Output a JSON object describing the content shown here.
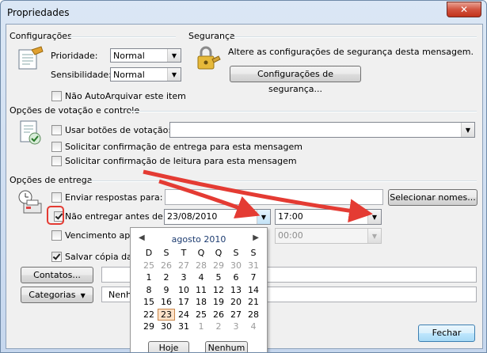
{
  "window": {
    "title": "Propriedades",
    "close_label": "✕"
  },
  "settings": {
    "section_label": "Configurações",
    "priority_label": "Prioridade:",
    "priority_value": "Normal",
    "sensitivity_label": "Sensibilidade:",
    "sensitivity_value": "Normal",
    "no_autoarchive_label": "Não AutoArquivar este item",
    "no_autoarchive_checked": false
  },
  "security": {
    "section_label": "Segurança",
    "description": "Altere as configurações de segurança desta mensagem.",
    "button_label": "Configurações de segurança..."
  },
  "voting": {
    "section_label": "Opções de votação e controle",
    "use_voting_label": "Usar botões de votação:",
    "use_voting_checked": false,
    "voting_value": "",
    "delivery_receipt_label": "Solicitar confirmação de entrega para esta mensagem",
    "delivery_receipt_checked": false,
    "read_receipt_label": "Solicitar confirmação de leitura para esta mensagem",
    "read_receipt_checked": false
  },
  "delivery": {
    "section_label": "Opções de entrega",
    "send_replies_label": "Enviar respostas para:",
    "send_replies_checked": false,
    "send_replies_value": "",
    "select_names_label": "Selecionar nomes...",
    "do_not_deliver_label": "Não entregar antes de:",
    "do_not_deliver_checked": true,
    "do_not_deliver_date": "23/08/2010",
    "do_not_deliver_time": "17:00",
    "expires_label": "Vencimento após:",
    "expires_checked": false,
    "expires_time": "00:00",
    "save_copy_label": "Salvar cópia da m",
    "save_copy_checked": true
  },
  "bottom": {
    "contacts_label": "Contatos...",
    "contacts_value": "",
    "categories_label": "Categorias",
    "categories_value": "Nenh",
    "close_button_label": "Fechar"
  },
  "calendar": {
    "month_label": "agosto 2010",
    "prev_icon": "◀",
    "next_icon": "▶",
    "weekday_headers": [
      "D",
      "S",
      "T",
      "Q",
      "Q",
      "S",
      "S"
    ],
    "weeks": [
      [
        "25",
        "26",
        "27",
        "28",
        "29",
        "30",
        "31"
      ],
      [
        "1",
        "2",
        "3",
        "4",
        "5",
        "6",
        "7"
      ],
      [
        "8",
        "9",
        "10",
        "11",
        "12",
        "13",
        "14"
      ],
      [
        "15",
        "16",
        "17",
        "18",
        "19",
        "20",
        "21"
      ],
      [
        "22",
        "23",
        "24",
        "25",
        "26",
        "27",
        "28"
      ],
      [
        "29",
        "30",
        "31",
        "1",
        "2",
        "3",
        "4"
      ]
    ],
    "selected_day": "23",
    "today_button": "Hoje",
    "none_button": "Nenhum"
  },
  "colors": {
    "annotation_red": "#e43b33",
    "today_highlight": "#fde2c8"
  }
}
